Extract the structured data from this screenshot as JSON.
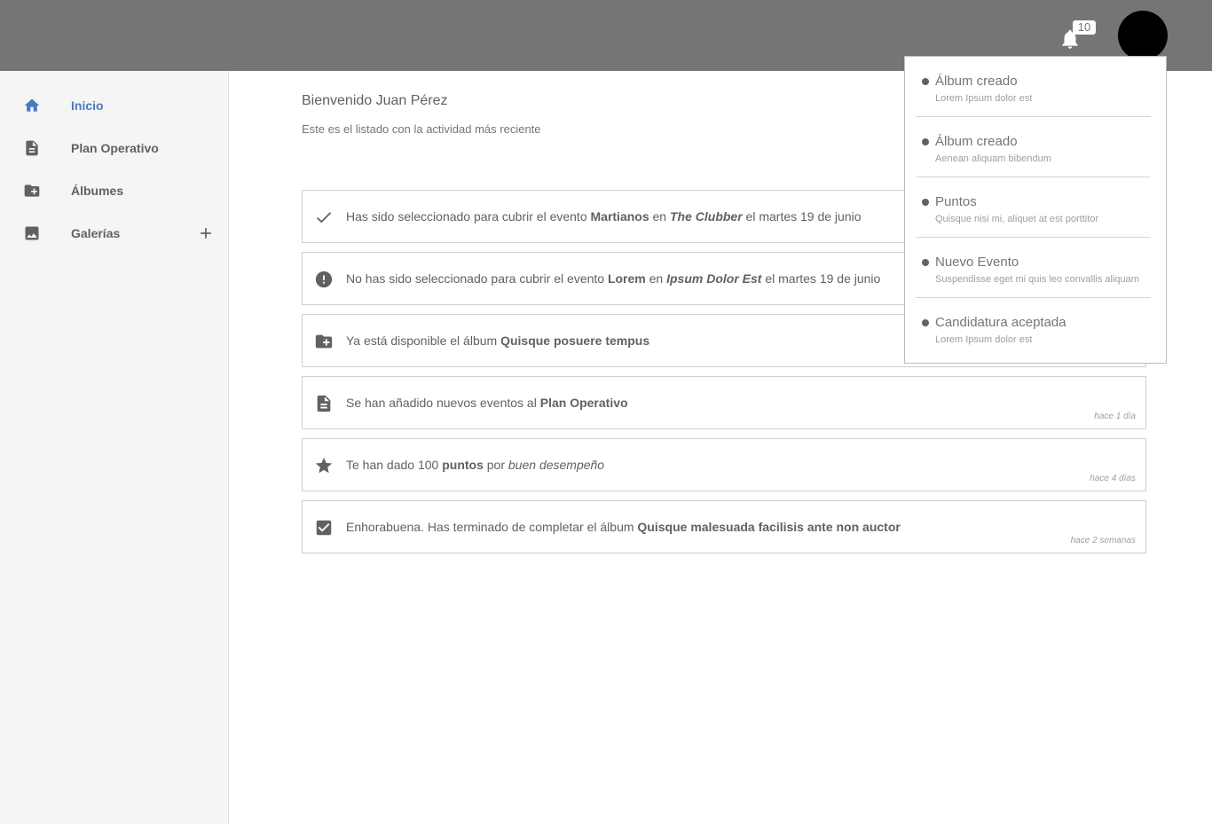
{
  "header": {
    "notification_count": "10"
  },
  "sidebar": {
    "items": [
      {
        "label": "Inicio",
        "icon": "home-icon",
        "active": true
      },
      {
        "label": "Plan Operativo",
        "icon": "document-icon"
      },
      {
        "label": "Álbumes",
        "icon": "folder-add-icon"
      },
      {
        "label": "Galerías",
        "icon": "image-icon",
        "expandable": true
      }
    ]
  },
  "main": {
    "welcome": "Bienvenido Juan Pérez",
    "subtitle": "Este es el listado con la actividad más reciente",
    "activities": [
      {
        "icon": "check-icon",
        "t1": "Has sido seleccionado para cubrir el evento ",
        "b1": "Martianos",
        "t2": " en ",
        "bi1": "The Clubber",
        "t3": " el martes 19 de junio",
        "time": ""
      },
      {
        "icon": "alert-circle-icon",
        "t1": "No has sido seleccionado para cubrir el evento ",
        "b1": "Lorem",
        "t2": " en ",
        "bi1": "Ipsum Dolor Est",
        "t3": " el martes 19 de junio",
        "time": ""
      },
      {
        "icon": "folder-add-icon",
        "t1": "Ya está disponible el álbum ",
        "b1": "Quisque posuere tempus",
        "time": ""
      },
      {
        "icon": "document-icon",
        "t1": "Se han añadido nuevos eventos al ",
        "b1": "Plan Operativo",
        "time": "hace 1 día"
      },
      {
        "icon": "star-icon",
        "t1": "Te han dado 100 ",
        "b1": "puntos",
        "t2": " por ",
        "i1": "buen desempeño",
        "time": "hace 4 días"
      },
      {
        "icon": "checkbox-icon",
        "t1": "Enhorabuena. Has terminado de completar el álbum ",
        "b1": "Quisque malesuada facilisis ante non auctor",
        "time": "hace 2 semanas"
      }
    ]
  },
  "notifications": [
    {
      "title": "Álbum creado",
      "desc": "Lorem Ipsum dolor est"
    },
    {
      "title": "Álbum creado",
      "desc": "Aenean aliquam bibendum"
    },
    {
      "title": "Puntos",
      "desc": "Quisque nisi mi, aliquet at est porttitor"
    },
    {
      "title": "Nuevo Evento",
      "desc": "Suspendisse eget mi quis leo convallis aliquam"
    },
    {
      "title": "Candidatura aceptada",
      "desc": "Lorem Ipsum dolor est"
    }
  ],
  "colors": {
    "topbar": "#757575",
    "accent": "#4a78c2",
    "icon": "#616161",
    "sidebar_bg": "#f5f5f5"
  }
}
